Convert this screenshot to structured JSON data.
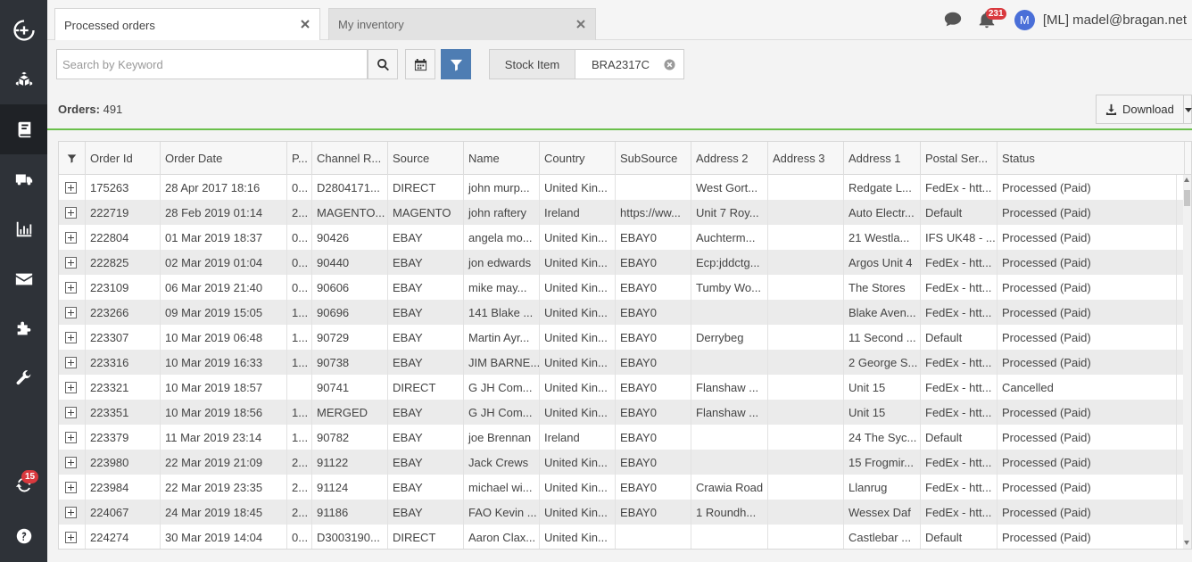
{
  "tabs": [
    {
      "label": "Processed orders",
      "active": true
    },
    {
      "label": "My inventory",
      "active": false
    }
  ],
  "header": {
    "notification_count": "231",
    "avatar_initial": "M",
    "user_name": "[ML] madel@bragan.net"
  },
  "sidebar": {
    "sync_badge": "15",
    "icons": [
      "add-circle-icon",
      "boxes-icon",
      "book-icon",
      "truck-icon",
      "bar-chart-icon",
      "mail-icon",
      "puzzle-icon",
      "wrench-icon",
      "sync-icon",
      "help-icon"
    ]
  },
  "search": {
    "placeholder": "Search by Keyword"
  },
  "filter_chip": {
    "label": "Stock Item",
    "value": "BRA2317C"
  },
  "orders": {
    "label": "Orders:",
    "count": "491"
  },
  "download": {
    "label": "Download"
  },
  "grid": {
    "columns": [
      "Order Id",
      "Order Date",
      "P...",
      "Channel R...",
      "Source",
      "Name",
      "Country",
      "SubSource",
      "Address 2",
      "Address 3",
      "Address 1",
      "Postal Ser...",
      "Status"
    ],
    "rows": [
      [
        "175263",
        "28 Apr 2017 18:16",
        "0...",
        "D2804171...",
        "DIRECT",
        "john murp...",
        "United Kin...",
        "",
        "West Gort...",
        "",
        "Redgate L...",
        "FedEx - htt...",
        "Processed (Paid)"
      ],
      [
        "222719",
        "28 Feb 2019 01:14",
        "2...",
        "MAGENTO...",
        "MAGENTO",
        "john raftery",
        "Ireland",
        "https://ww...",
        "Unit 7 Roy...",
        "",
        "Auto Electr...",
        "Default",
        "Processed (Paid)"
      ],
      [
        "222804",
        "01 Mar 2019 18:37",
        "0...",
        "90426",
        "EBAY",
        "angela mo...",
        "United Kin...",
        "EBAY0",
        "Auchterm...",
        "",
        "21 Westla...",
        "IFS UK48 - ...",
        "Processed (Paid)"
      ],
      [
        "222825",
        "02 Mar 2019 01:04",
        "0...",
        "90440",
        "EBAY",
        "jon edwards",
        "United Kin...",
        "EBAY0",
        "Ecp:jddctg...",
        "",
        "Argos Unit 4",
        "FedEx - htt...",
        "Processed (Paid)"
      ],
      [
        "223109",
        "06 Mar 2019 21:40",
        "0...",
        "90606",
        "EBAY",
        "mike may...",
        "United Kin...",
        "EBAY0",
        "Tumby Wo...",
        "",
        "The Stores",
        "FedEx - htt...",
        "Processed (Paid)"
      ],
      [
        "223266",
        "09 Mar 2019 15:05",
        "1...",
        "90696",
        "EBAY",
        "141 Blake ...",
        "United Kin...",
        "EBAY0",
        "",
        "",
        "Blake Aven...",
        "FedEx - htt...",
        "Processed (Paid)"
      ],
      [
        "223307",
        "10 Mar 2019 06:48",
        "1...",
        "90729",
        "EBAY",
        "Martin Ayr...",
        "United Kin...",
        "EBAY0",
        "Derrybeg",
        "",
        "11 Second ...",
        "Default",
        "Processed (Paid)"
      ],
      [
        "223316",
        "10 Mar 2019 16:33",
        "1...",
        "90738",
        "EBAY",
        "JIM BARNE...",
        "United Kin...",
        "EBAY0",
        "",
        "",
        "2 George S...",
        "FedEx - htt...",
        "Processed (Paid)"
      ],
      [
        "223321",
        "10 Mar 2019 18:57",
        "",
        "90741",
        "DIRECT",
        "G JH Com...",
        "United Kin...",
        "EBAY0",
        "Flanshaw ...",
        "",
        "Unit 15",
        "FedEx - htt...",
        "Cancelled"
      ],
      [
        "223351",
        "10 Mar 2019 18:56",
        "1...",
        "MERGED",
        "EBAY",
        "G JH Com...",
        "United Kin...",
        "EBAY0",
        "Flanshaw ...",
        "",
        "Unit 15",
        "FedEx - htt...",
        "Processed (Paid)"
      ],
      [
        "223379",
        "11 Mar 2019 23:14",
        "1...",
        "90782",
        "EBAY",
        "joe Brennan",
        "Ireland",
        "EBAY0",
        "",
        "",
        "24 The Syc...",
        "Default",
        "Processed (Paid)"
      ],
      [
        "223980",
        "22 Mar 2019 21:09",
        "2...",
        "91122",
        "EBAY",
        "Jack Crews",
        "United Kin...",
        "EBAY0",
        "",
        "",
        "15 Frogmir...",
        "FedEx - htt...",
        "Processed (Paid)"
      ],
      [
        "223984",
        "22 Mar 2019 23:35",
        "2...",
        "91124",
        "EBAY",
        "michael wi...",
        "United Kin...",
        "EBAY0",
        "Crawia Road",
        "",
        "Llanrug",
        "FedEx - htt...",
        "Processed (Paid)"
      ],
      [
        "224067",
        "24 Mar 2019 18:45",
        "2...",
        "91186",
        "EBAY",
        "FAO Kevin ...",
        "United Kin...",
        "EBAY0",
        "1 Roundh...",
        "",
        "Wessex Daf",
        "FedEx - htt...",
        "Processed (Paid)"
      ],
      [
        "224274",
        "30 Mar 2019 14:04",
        "0...",
        "D3003190...",
        "DIRECT",
        "Aaron Clax...",
        "United Kin...",
        "",
        "",
        "",
        "Castlebar ...",
        "Default",
        "Processed (Paid)"
      ]
    ]
  }
}
